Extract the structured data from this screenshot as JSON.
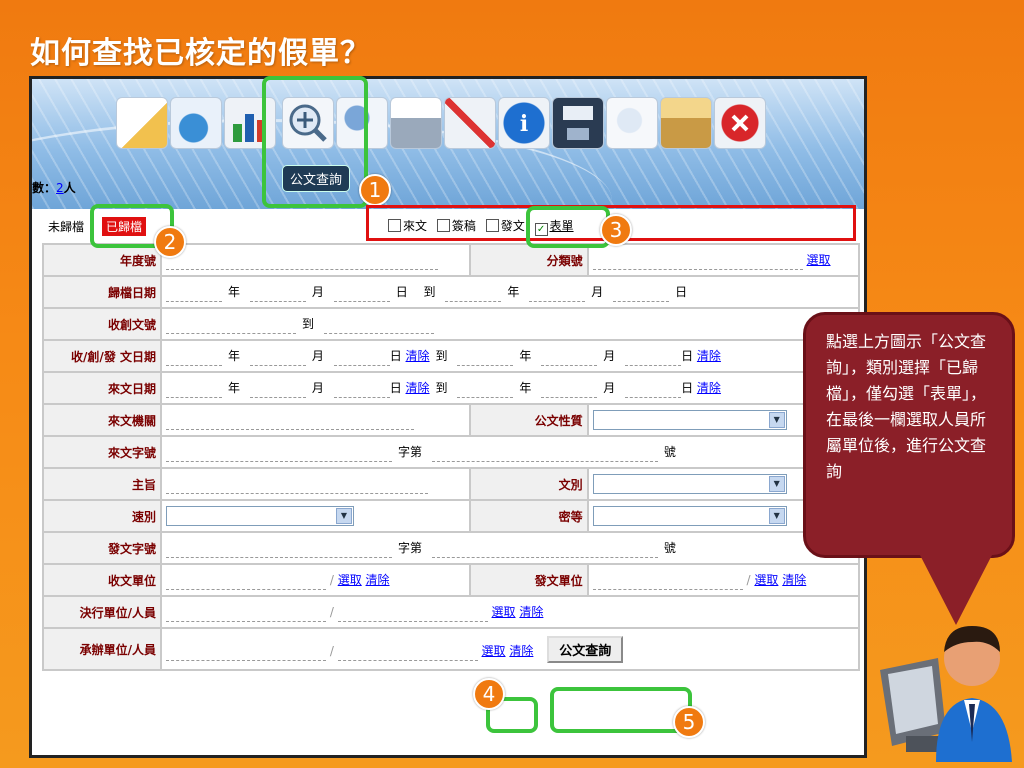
{
  "slide": {
    "title": "如何查找已核定的假單？"
  },
  "toolbar": {
    "member_label": "數：",
    "member_count": "2",
    "member_unit": "人",
    "tooltip": "公文查詢",
    "icons": [
      "edit-document-icon",
      "web-document-icon",
      "chart-icon",
      "search-document-icon",
      "search-user-icon",
      "print-icon",
      "tools-icon",
      "info-icon",
      "save-icon",
      "search-files-icon",
      "archive-icon",
      "close-icon"
    ]
  },
  "tabs": {
    "unarchived": "未歸檔",
    "archived": "已歸檔"
  },
  "filters": [
    {
      "label": "來文",
      "checked": false
    },
    {
      "label": "簽稿",
      "checked": false
    },
    {
      "label": "發文",
      "checked": false
    },
    {
      "label": "表單",
      "checked": true
    }
  ],
  "form": {
    "year_no": "年度號",
    "category_no": "分類號",
    "select": "選取",
    "archive_date": "歸檔日期",
    "year": "年",
    "month": "月",
    "day": "日",
    "to": "到",
    "doc_no": "收創文號",
    "recv_date": "收/創/發 文日期",
    "clear": "清除",
    "incoming_date": "來文日期",
    "incoming_org": "來文機關",
    "doc_nature": "公文性質",
    "incoming_word": "來文字號",
    "word_no": "字第",
    "number": "號",
    "subject": "主旨",
    "doc_type": "文別",
    "speed": "速別",
    "secret": "密等",
    "outgoing_word": "發文字號",
    "recv_unit": "收文單位",
    "send_unit": "發文單位",
    "decide_unit": "決行單位/人員",
    "handle_unit": "承辦單位/人員",
    "slash": "/",
    "search_button": "公文查詢"
  },
  "badges": [
    "1",
    "2",
    "3",
    "4",
    "5"
  ],
  "callout": {
    "text": "點選上方圖示「公文查詢」，類別選擇「已歸檔」，僅勾選「表單」，在最後一欄選取人員所屬單位後，進行公文查詢"
  },
  "colors": {
    "background": "#f07a10",
    "callout": "#8b1f28",
    "highlight": "#3cc43c",
    "alert": "#e01010"
  }
}
